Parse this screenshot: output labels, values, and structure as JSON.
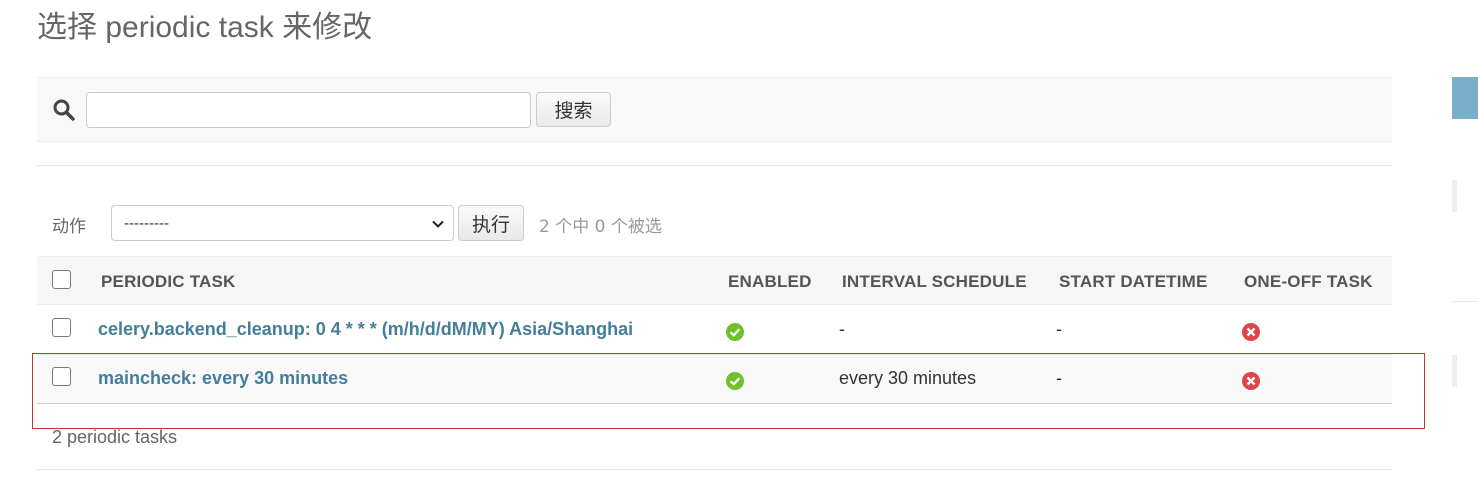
{
  "page_title": "选择 periodic task 来修改",
  "search": {
    "value": "",
    "placeholder": "",
    "button_label": "搜索"
  },
  "actions": {
    "label": "动作",
    "selected_option": "---------",
    "go_label": "执行",
    "selection_count": "2 个中 0 个被选"
  },
  "table": {
    "columns": [
      "PERIODIC TASK",
      "ENABLED",
      "INTERVAL SCHEDULE",
      "START DATETIME",
      "ONE-OFF TASK"
    ],
    "rows": [
      {
        "task": "celery.backend_cleanup: 0 4 * * * (m/h/d/dM/MY) Asia/Shanghai",
        "enabled": true,
        "interval_schedule": "-",
        "start_datetime": "-",
        "one_off_task": false
      },
      {
        "task": "maincheck: every 30 minutes",
        "enabled": true,
        "interval_schedule": "every 30 minutes",
        "start_datetime": "-",
        "one_off_task": false
      }
    ]
  },
  "paginator": "2 periodic tasks",
  "colors": {
    "link": "#447e9b",
    "enabled_icon": "#70bf2b",
    "disabled_icon": "#dd4646",
    "highlight_border": "#d03030",
    "sidebar_accent": "#79aec8"
  },
  "icons": {
    "search": "search-icon",
    "yes": "check-circle-icon",
    "no": "x-circle-icon",
    "select_arrow": "chevron-down-icon"
  }
}
